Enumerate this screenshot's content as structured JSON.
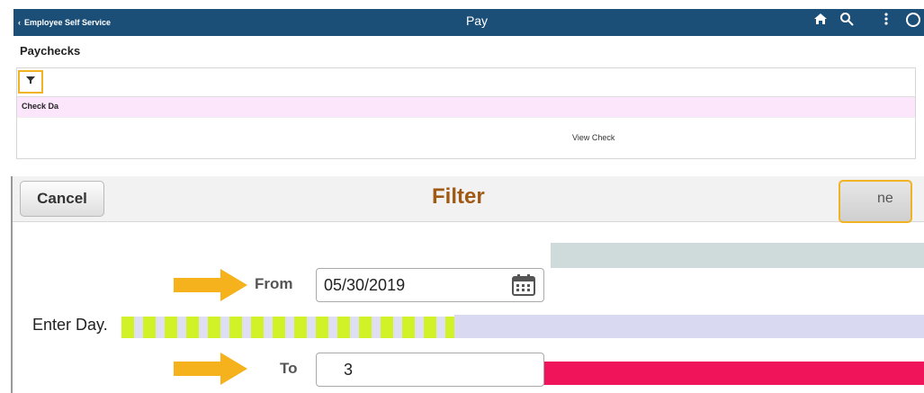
{
  "topbar": {
    "back_label": "Employee Self Service",
    "title": "Pay",
    "icons": [
      "home-icon",
      "search-icon",
      "more-vert-icon",
      "navbar-icon"
    ],
    "color": "#1c4f78"
  },
  "paychecks": {
    "title": "Paychecks",
    "column_header": "Check Da",
    "view_check": "View Check"
  },
  "filter_modal": {
    "cancel_label": "Cancel",
    "title": "Filter",
    "done_label": "ne",
    "from_label": "From",
    "from_value": "05/30/2019",
    "enter_day_label": "Enter Day.",
    "to_label": "To",
    "to_value": "3",
    "accent": "#f0b323",
    "title_color": "#a05a14"
  }
}
